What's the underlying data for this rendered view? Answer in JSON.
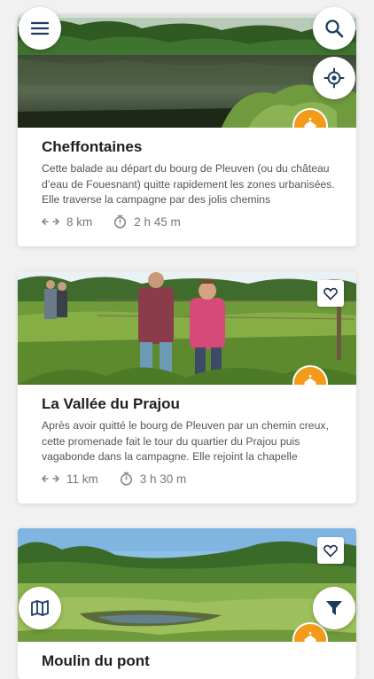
{
  "trails": [
    {
      "title": "Cheffontaines",
      "description": "Cette balade au départ du bourg de Pleuven (ou du château d’eau de Fouesnant) quitte rapidement les zones urbanisées. Elle traverse la campagne par des jolis chemins",
      "distance": "8 km",
      "duration": "2 h 45 m",
      "badge_icon": "chapel-icon"
    },
    {
      "title": "La Vallée du Prajou",
      "description": "Après avoir quitté le bourg de Pleuven par un chemin creux, cette promenade fait le tour du quartier du Prajou puis vagabonde dans la campagne. Elle rejoint la chapelle",
      "distance": "11 km",
      "duration": "3 h 30 m",
      "badge_icon": "chapel-icon"
    },
    {
      "title": "Moulin du pont",
      "badge_icon": "chapel-icon"
    }
  ],
  "icons": {
    "menu": "menu-icon",
    "search": "search-icon",
    "locate": "locate-icon",
    "map": "map-icon",
    "filter": "filter-icon",
    "favorite": "heart-icon",
    "distance": "distance-arrows-icon",
    "duration": "stopwatch-icon"
  },
  "colors": {
    "accent": "#f29a1a",
    "primary_icon": "#1e3a5f",
    "background": "#f1f1f1",
    "text_muted": "#777777"
  }
}
